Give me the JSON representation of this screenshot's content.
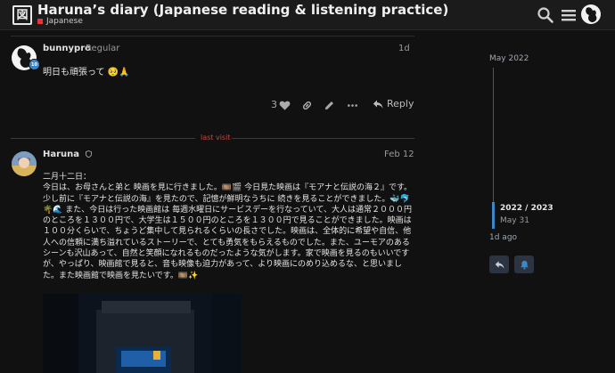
{
  "header": {
    "logo_glyph": "図",
    "title": "Haruna’s diary (Japanese reading & listening practice)",
    "category": "Japanese",
    "category_color": "#e4343a"
  },
  "posts": [
    {
      "username": "bunnypro",
      "user_title": "Regular",
      "flair": "10",
      "date": "1d",
      "body": "明日も頑張って 🥺🙏",
      "like_count": "3",
      "reply_label": "Reply"
    },
    {
      "username": "Haruna",
      "date": "Feb 12",
      "paragraphs": [
        "二月十二日：",
        "今日は、お母さんと弟と 映画を見に行きました。🎞️🎬 今日見た映画は『モアナと伝説の海２』です。少し前に『モアナと伝説の海』を見たので、記憶が鮮明なうちに 続きを見ることができました。🐳🐬🌴🌊 また、今日は行った映画館は 毎週水曜日にサービスデーを行なっていて、大人は通常２０００円のところを１３００円で、大学生は１５００円のところを１３００円で見ることができました。映画は１００分くらいで、ちょうど集中して見られるくらいの長さでした。映画は、全体的に希望や自信、他人への信頼に満ち溢れているストーリーで、とても勇気をもらえるものでした。また、ユーモアのあるシーンも沢山あって、自然と笑顔になれるものだったような気がします。家で映画を見るのもいいですが、やっぱり、映画館で見ると、音も映像も迫力があって、より映画にのめり込めるな、と思いました。また映画館で映画を見たいです。🎞️✨"
      ]
    }
  ],
  "last_visit_label": "last visit",
  "timeline": {
    "start_label": "May 2022",
    "position_label": "2022 / 2023",
    "position_date": "May 31",
    "end_label": "1d ago"
  },
  "colors": {
    "accent": "#3b87c8",
    "last_visit": "#c24848",
    "background": "#111111"
  }
}
